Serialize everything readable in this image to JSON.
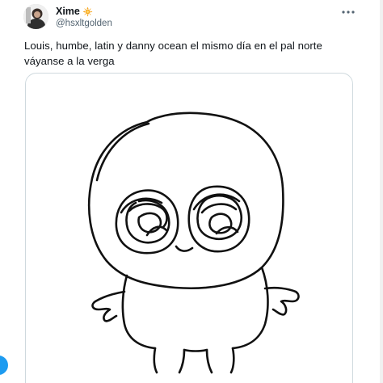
{
  "tweet": {
    "author": {
      "display_name": "Xime",
      "handle": "@hsxltgolden",
      "badge_icon": "orange-sun-badge-icon"
    },
    "text": "Louis, humbe, latin y danny ocean el mismo día en el pal norte váyanse a la verga",
    "more_icon": "more-horizontal-icon",
    "media_icon": "hand-drawn-creature-drawing"
  },
  "colors": {
    "text_primary": "#0f1419",
    "text_secondary": "#536471",
    "border": "#cfd9de",
    "accent": "#1d9bf0",
    "badge": "#f7a51c"
  }
}
